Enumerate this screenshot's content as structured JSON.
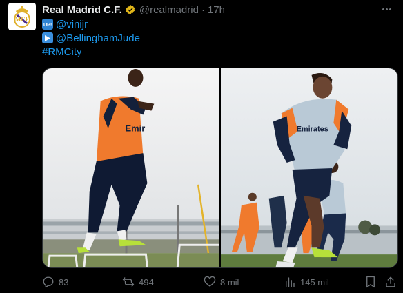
{
  "author": {
    "display_name": "Real Madrid C.F.",
    "handle": "@realmadrid",
    "separator": "·",
    "time": "17h"
  },
  "body": {
    "line1": {
      "emoji_label": "UP!",
      "mention": "@vinijr"
    },
    "line2": {
      "emoji_label": "▶",
      "mention": "@BellinghamJude"
    },
    "line3": {
      "hashtag": "#RMCity"
    }
  },
  "photos": [
    {
      "shirt_text": "Emir"
    },
    {
      "shirt_text": "Emirates"
    }
  ],
  "actions": {
    "replies": "83",
    "reposts": "494",
    "likes": "8 mil",
    "views": "145 mil"
  },
  "colors": {
    "background": "#000000",
    "text": "#e7e9ea",
    "muted": "#71767b",
    "link": "#1d9bf0",
    "verified_gold": "#e2b719"
  },
  "icons": [
    "club-crest-icon",
    "verified-badge-icon",
    "more-icon",
    "reply-icon",
    "repost-icon",
    "like-icon",
    "views-icon",
    "bookmark-icon",
    "share-icon"
  ]
}
